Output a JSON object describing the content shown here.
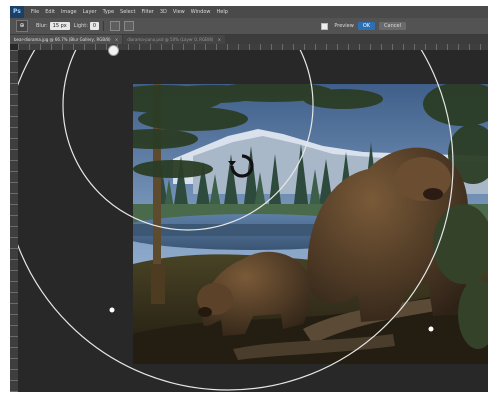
{
  "app": {
    "logo": "Ps"
  },
  "menu": [
    "File",
    "Edit",
    "Image",
    "Layer",
    "Type",
    "Select",
    "Filter",
    "3D",
    "View",
    "Window",
    "Help"
  ],
  "options": {
    "tool_glyph": "⊕",
    "blur_label": "Blur:",
    "blur_value": "15 px",
    "light_label": "Light:",
    "light_value": "0",
    "preview_label": "Preview",
    "ok_label": "OK",
    "cancel_label": "Cancel"
  },
  "tabs": [
    {
      "label": "bear-diorama.jpg @ 66.7% (Blur Gallery, RGB/8)",
      "close": "×",
      "active": true
    },
    {
      "label": "diorama-pano.psd @ 50% (Layer 0, RGB/8)",
      "close": "×",
      "active": false
    }
  ],
  "icons": {
    "tool": "iris-blur-tool-icon",
    "center_pin": "blur-center-pin-icon",
    "pin": "blur-pin-icon",
    "busy": "busy-spinner-icon"
  },
  "colors": {
    "accent": "#2c6fb3",
    "background": "#282828",
    "panel": "#535353"
  }
}
